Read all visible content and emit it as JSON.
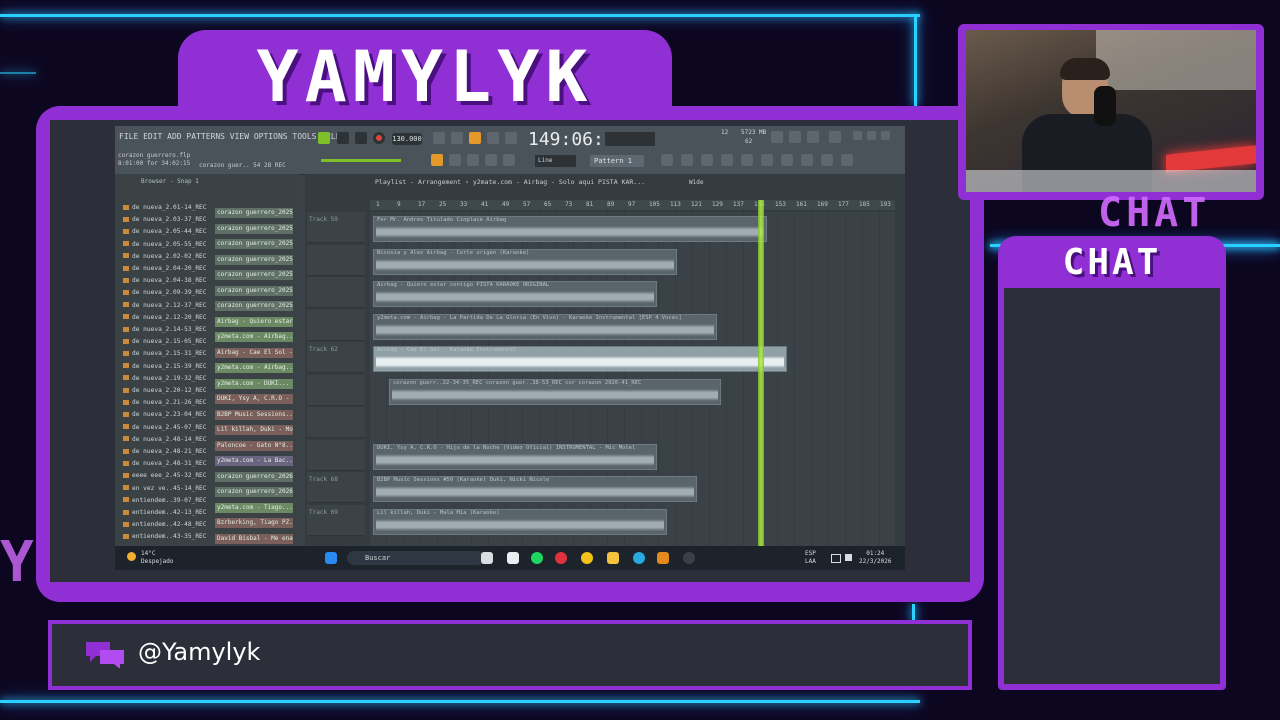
{
  "overlay": {
    "channel_title": "YAMYLYK",
    "chat_title": "CHAT",
    "chat_ghost": "CHAT",
    "handle": "@Yamylyk"
  },
  "fl_studio": {
    "menu": "FILE EDIT ADD PATTERNS VIEW OPTIONS TOOLS HELP",
    "bpm": "130.000",
    "time": "149:06:13",
    "project_name": "corazon guerrero.flp",
    "project_status": "8:01:00 for 34:02:15",
    "hint": "corazon guer.. 54 28 REC",
    "pattern": "Pattern 1",
    "cpu": "12",
    "mem": "5723 MB",
    "poly": "62",
    "snap": "Line",
    "browser_header": "Browser - Snap 1",
    "playlist_title": "Playlist - Arrangement › y2mate.com - Airbag - Solo aqui PISTA KAR...",
    "wide_label": "Wide",
    "ruler": [
      "1",
      "9",
      "17",
      "25",
      "33",
      "41",
      "49",
      "57",
      "65",
      "73",
      "81",
      "89",
      "97",
      "105",
      "113",
      "121",
      "129",
      "137",
      "145",
      "153",
      "161",
      "169",
      "177",
      "185",
      "193"
    ],
    "browser_items": [
      "de nueva_2.01-14_REC",
      "de nueva_2.03-37_REC",
      "de nueva_2.05-44_REC",
      "de nueva_2.05-55_REC",
      "de nueva_2.02-02_REC",
      "de nueva_2.04-20_REC",
      "de nueva_2.04-38_REC",
      "de nueva_2.09-39_REC",
      "de nueva_2.12-37_REC",
      "de nueva_2.12-20_REC",
      "de nueva_2.14-53_REC",
      "de nueva_2.15-05_REC",
      "de nueva_2.15-31_REC",
      "de nueva_2.15-39_REC",
      "de nueva_2.19-32_REC",
      "de nueva_2.20-12_REC",
      "de nueva_2.21-26_REC",
      "de nueva_2.23-04_REC",
      "de nueva_2.45-07_REC",
      "de nueva_2.48-14_REC",
      "de nueva_2.48-21_REC",
      "de nueva_2.48-31_REC",
      "eeee eee_2.45-32_REC",
      "en vez ve..45-14_REC",
      "entiendem..39-07_REC",
      "entiendem..42-13_REC",
      "entiendem..42-48_REC",
      "entiendem..43-35_REC"
    ],
    "channels": [
      {
        "label": "corazon guerrero_2025-",
        "color": "#5f7166"
      },
      {
        "label": "corazon guerrero_2025-",
        "color": "#5f7166"
      },
      {
        "label": "corazon guerrero_2025-",
        "color": "#5f7166"
      },
      {
        "label": "corazon guerrero_2025-",
        "color": "#5f7166"
      },
      {
        "label": "corazon guerrero_2025-",
        "color": "#5f7166"
      },
      {
        "label": "corazon guerrero_2025-",
        "color": "#5f7166"
      },
      {
        "label": "corazon guerrero_2025-",
        "color": "#5f7166"
      },
      {
        "label": "Airbag - Quiero estar...",
        "color": "#6b8a64"
      },
      {
        "label": "y2meta.com - Airbag...",
        "color": "#6b8a64"
      },
      {
        "label": "Airbag - Cae El Sol -...",
        "color": "#7a5f5a"
      },
      {
        "label": "y2meta.com - Airbag...",
        "color": "#6b8a64"
      },
      {
        "label": "y2meta.com - DUKI...",
        "color": "#6b8a64"
      },
      {
        "label": "DUKI, Ysy A, C.R.O - N...",
        "color": "#7a5f5a"
      },
      {
        "label": "B2BP Music Sessions...",
        "color": "#7a5f5a"
      },
      {
        "label": "Lil killah, Duki - Mol...",
        "color": "#7a5f5a"
      },
      {
        "label": "Paloncoe - Gato N°8...",
        "color": "#7a5f5a"
      },
      {
        "label": "y2meta.com - La Bac...",
        "color": "#6b6480"
      },
      {
        "label": "corazon guerrero_2026-",
        "color": "#5f7166"
      },
      {
        "label": "corazon guerrero_2026-",
        "color": "#5f7166"
      },
      {
        "label": "y2meta.com - Tiago...",
        "color": "#6b8a64"
      },
      {
        "label": "Bzrberking, Tiago PZ...",
        "color": "#7a5f5a"
      },
      {
        "label": "David Bisbal - Me ena...",
        "color": "#7a5f5a"
      }
    ],
    "tracks": [
      {
        "label": "Track 59",
        "clip": "Fer Mr. Andres Titulado Cinplace Airbag"
      },
      {
        "label": "",
        "clip": "Nicosia y Alex Airbag - Corte origen (Karaoke)"
      },
      {
        "label": "",
        "clip": "Airbag - Quiero estar contigo PISTA KARAOKE ORIGINAL"
      },
      {
        "label": "",
        "clip": "y2meta.com - Airbag - La Partida De La Gloria (En Vivo) - Karaoke Instrumental [ESP 4 Voces]"
      },
      {
        "label": "Track 62",
        "clip": "Airbag - Cae El Sol - Karaoke Instrumental"
      },
      {
        "label": "",
        "clip": "corazon guerr..22-34-35_REC  corazon guer..38-53_REC  cor  corazon 2026-41_REC"
      },
      {
        "label": "",
        "clip": ""
      },
      {
        "label": "",
        "clip": "DUKI, Ysy A, C.R.O - Hijo de la Noche (Video Oficial) INSTRUMENTAL - Mic Motel"
      },
      {
        "label": "Track 68",
        "clip": "B2BP Music Sessions #50 (Karaoke) Duki, Nicki Nicole"
      },
      {
        "label": "Track 69",
        "clip": "Lil killah, Duki - Mala Mia (Karaoke)"
      }
    ],
    "taskbar": {
      "temp": "14°C",
      "weather": "Despejado",
      "search": "Buscar",
      "lang1": "ESP",
      "lang2": "LAA",
      "clock": "01:24",
      "date": "22/3/2026"
    }
  },
  "colors": {
    "neon_purple": "#8f2fd4",
    "neon_blue": "#2ad0ff",
    "panel_dark": "#2c2f3a"
  }
}
